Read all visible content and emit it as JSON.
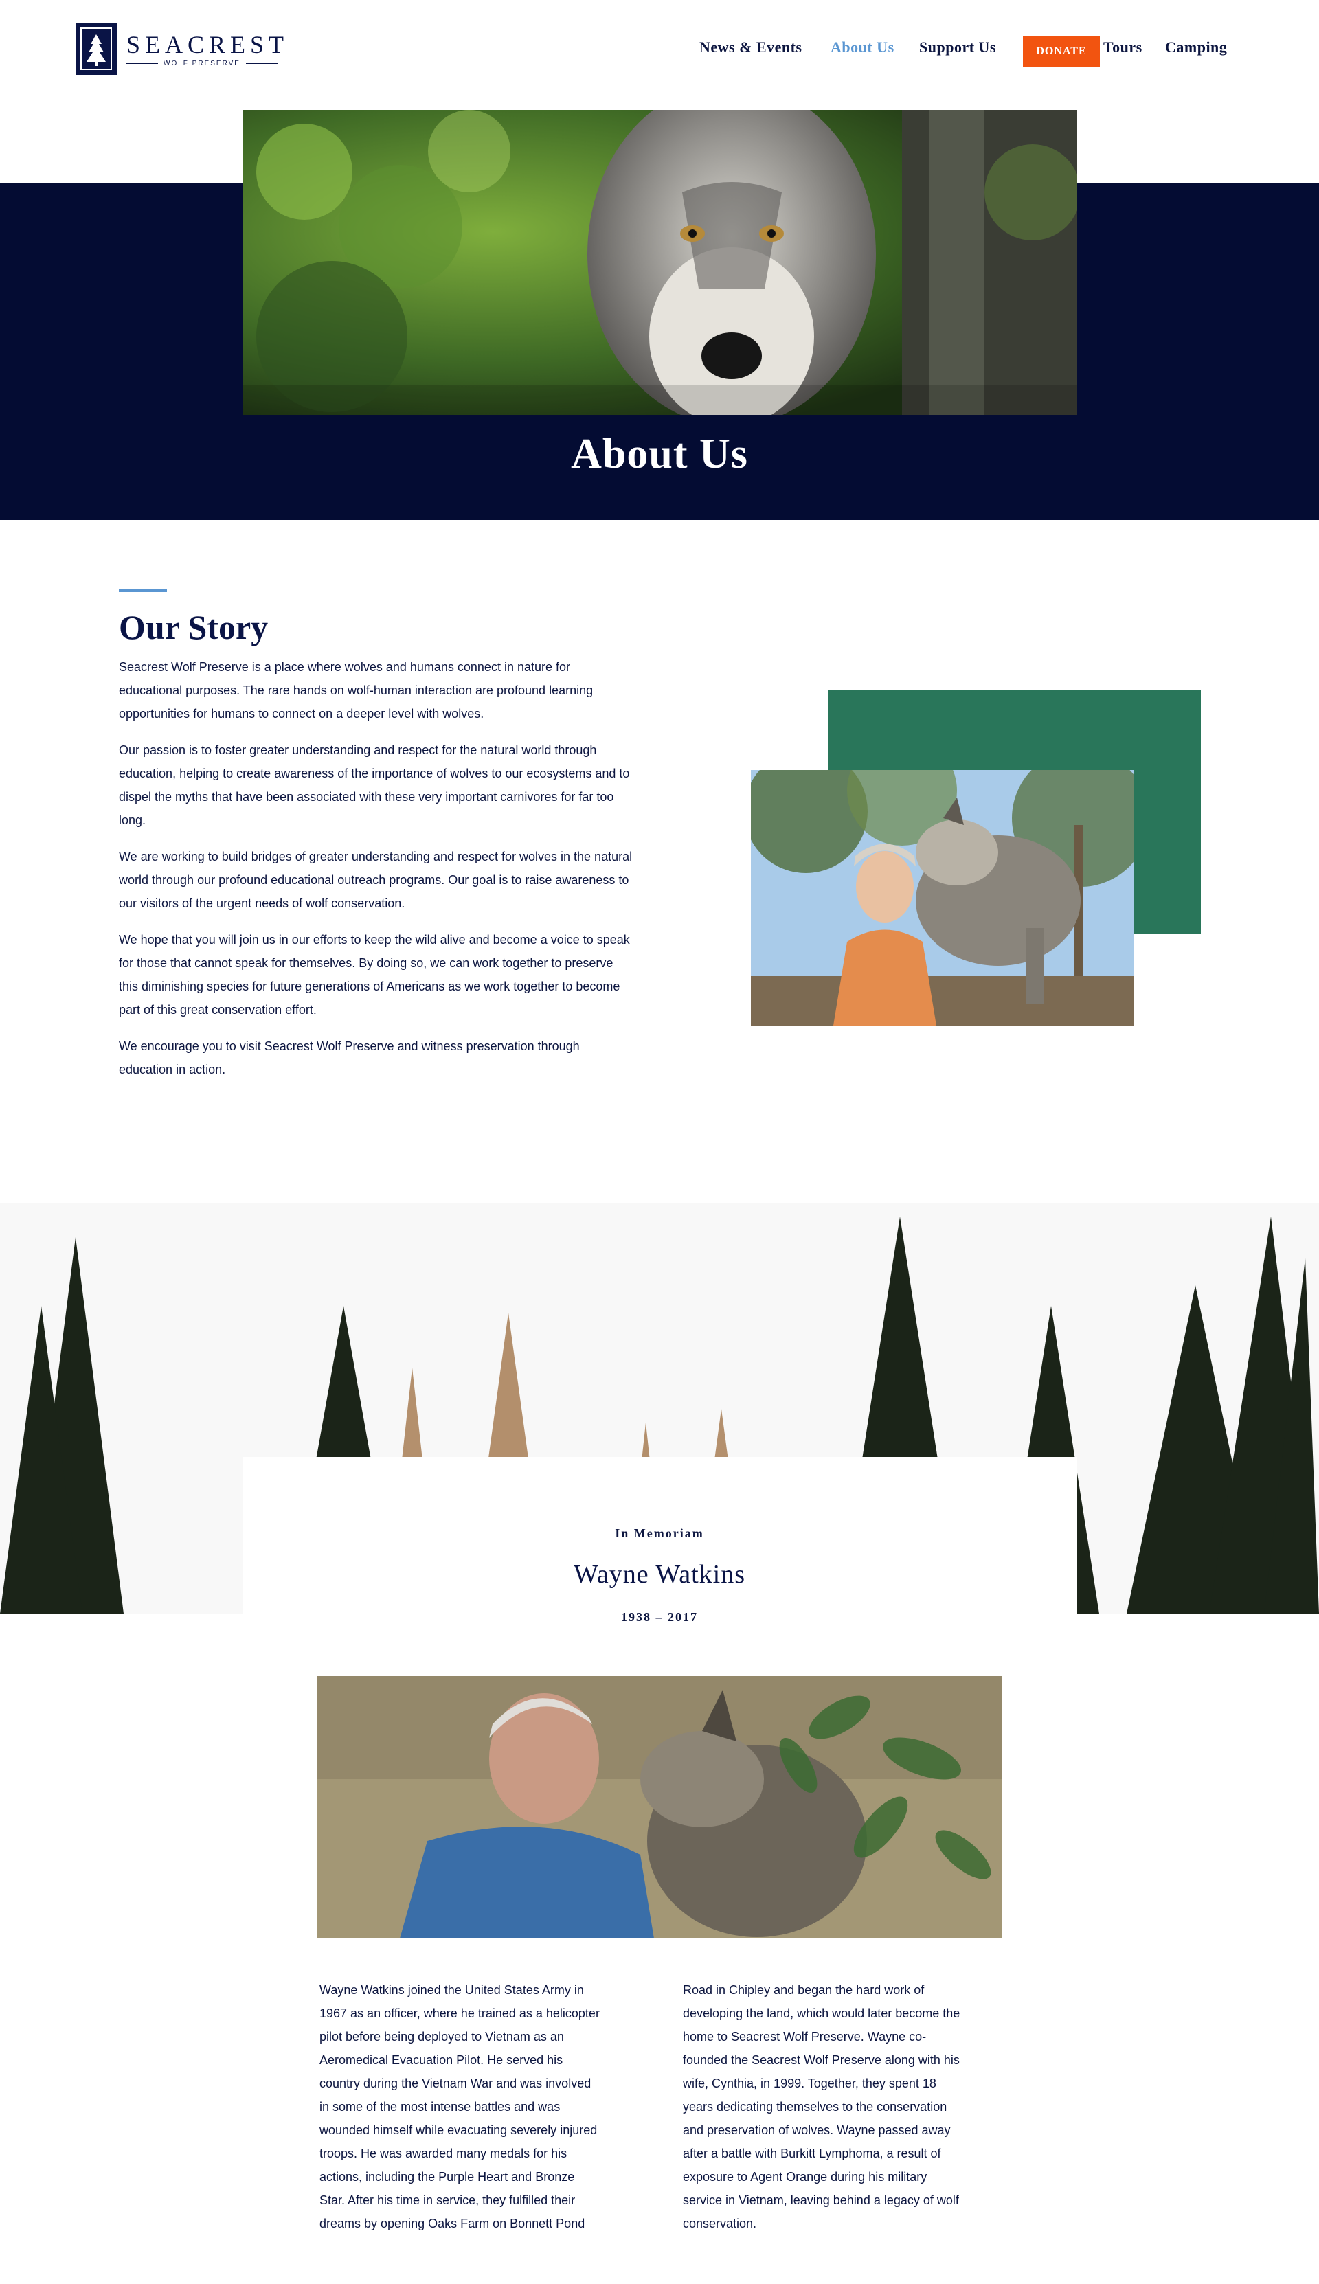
{
  "logo": {
    "name": "SEACREST",
    "tagline": "WOLF PRESERVE"
  },
  "nav": {
    "items": [
      {
        "label": "News & Events",
        "active": false
      },
      {
        "label": "About Us",
        "active": true
      },
      {
        "label": "Support Us",
        "active": false
      },
      {
        "label": "DONATE",
        "active": false
      },
      {
        "label": "Tours",
        "active": false
      },
      {
        "label": "Camping",
        "active": false
      }
    ]
  },
  "colors": {
    "navy": "#040c33",
    "accent_blue": "#5a96d2",
    "donate_orange": "#f25410",
    "forest_green": "#29765a"
  },
  "hero": {
    "title": "About Us"
  },
  "story": {
    "heading": "Our Story",
    "paragraphs": [
      "Seacrest Wolf Preserve is a place where wolves and humans connect in nature for educational purposes. The rare hands on wolf-human interaction are profound learning opportunities for humans to connect on a deeper level with wolves.",
      "Our passion is to foster greater understanding and respect for the natural world through education, helping to create awareness of the importance of wolves to our ecosystems and to dispel the myths that have been associated with these very important carnivores for far too long.",
      "We are working to build bridges of greater understanding and respect for wolves in the natural world through our profound educational outreach programs. Our goal is to raise awareness to our visitors of the urgent needs of wolf conservation.",
      "We hope that you will join us in our efforts to keep the wild alive and become a voice to speak for those that cannot speak for themselves. By doing so, we can work together to preserve this diminishing species for future generations of Americans as we work together to become part of this great conservation effort.",
      "We encourage you to visit Seacrest Wolf Preserve and witness preservation through education in action."
    ]
  },
  "memoriam": {
    "kicker": "In Memoriam",
    "name": "Wayne Watkins",
    "dates": "1938 – 2017",
    "bio_left": "Wayne Watkins joined the United States Army in\n1967 as an officer, where he trained as a helicopter\npilot before being deployed to Vietnam as an\nAeromedical Evacuation Pilot. He served his\ncountry during the Vietnam War and was involved\nin some of the most intense battles and was\nwounded himself while evacuating severely injured\ntroops. He was awarded many medals for his\nactions, including the Purple Heart and Bronze\nStar. After his time in service, they fulfilled their\ndreams by opening Oaks Farm on Bonnett Pond",
    "bio_right": "Road in Chipley and began the hard work of\ndeveloping the land, which would later become the\nhome to Seacrest Wolf Preserve. Wayne co-\nfounded the Seacrest Wolf Preserve along with his\nwife, Cynthia, in 1999. Together, they spent 18\nyears dedicating themselves to the conservation\nand preservation of wolves. Wayne passed away\n after a battle with Burkitt Lymphoma, a result of\nexposure to Agent Orange during his military\nservice in Vietnam, leaving behind a legacy of wolf\nconservation."
  }
}
